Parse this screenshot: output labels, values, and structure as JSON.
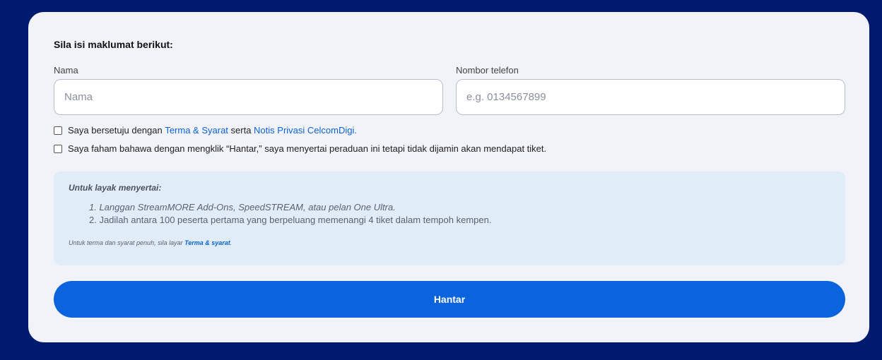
{
  "form": {
    "heading": "Sila isi maklumat berikut:",
    "name_label": "Nama",
    "name_value": "",
    "name_placeholder": "Nama",
    "phone_label": "Nombor telefon",
    "phone_value": "",
    "phone_placeholder": "e.g. 0134567899",
    "consent": {
      "text_before": "Saya bersetuju dengan ",
      "terms_link": "Terma & Syarat",
      "text_middle": " serta ",
      "privacy_link": "Notis Privasi CelcomDigi.",
      "checked": false
    },
    "acknowledge": {
      "text": "Saya faham bahawa dengan mengklik “Hantar,” saya menyertai peraduan ini tetapi tidak dijamin akan mendapat tiket.",
      "checked": false
    },
    "eligibility": {
      "title": "Untuk layak menyertai:",
      "items": [
        "1. Langgan StreamMORE Add-Ons, SpeedSTREAM, atau pelan One Ultra.",
        "2. Jadilah antara 100 peserta pertama yang berpeluang memenangi 4 tiket dalam tempoh kempen."
      ],
      "note_text": "Untuk terma dan syarat penuh, sila layar ",
      "note_link": "Terma & syarat",
      "note_end": "."
    },
    "submit_label": "Hantar"
  },
  "colors": {
    "page_background": "#001a6e",
    "card_background": "#f1f3f9",
    "info_background": "#e1ecf9",
    "link": "#0b62d6",
    "button": "#0b64dd"
  }
}
